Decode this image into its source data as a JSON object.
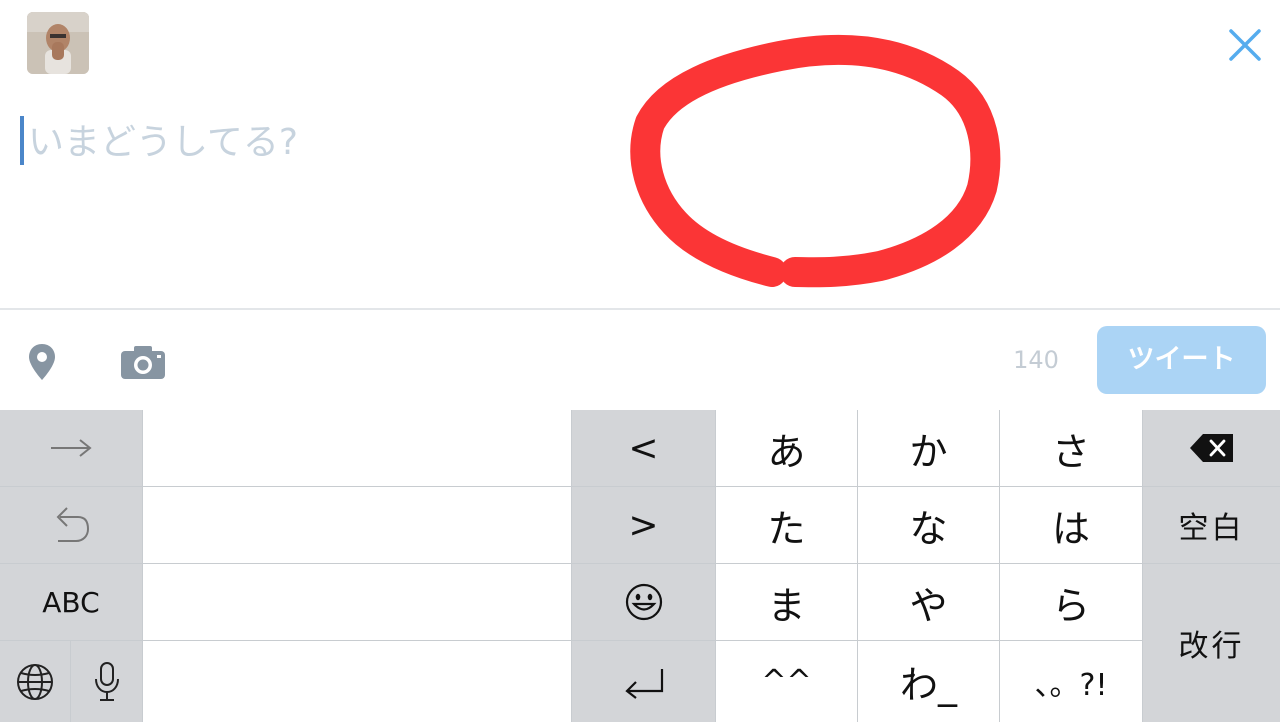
{
  "compose": {
    "placeholder": "いまどうしてる?",
    "annotation_color": "#fb3536"
  },
  "toolbar": {
    "char_count": "140",
    "tweet_label": "ツイート",
    "location_icon": "location-pin-icon",
    "camera_icon": "camera-icon"
  },
  "keyboard": {
    "left_column": {
      "arrow_icon": "arrow-right-icon",
      "undo_icon": "undo-icon",
      "abc_label": "ABC",
      "globe_icon": "globe-icon",
      "mic_icon": "microphone-icon"
    },
    "nav_column": {
      "left": "<",
      "right": ">",
      "emoji_icon": "emoji-icon",
      "return_icon": "return-icon"
    },
    "kana": [
      [
        "あ",
        "か",
        "さ"
      ],
      [
        "た",
        "な",
        "は"
      ],
      [
        "ま",
        "や",
        "ら"
      ],
      [
        "^^",
        "わ_",
        "、。?!"
      ]
    ],
    "right_column": {
      "delete_icon": "delete-icon",
      "space_label": "空白",
      "enter_label": "改行"
    }
  },
  "colors": {
    "accent": "#55acee",
    "tweet_button_bg": "#abd4f5",
    "key_gray": "#d3d5d8",
    "key_white": "#ffffff",
    "placeholder": "#c7d3de",
    "caret": "#4b86c9"
  }
}
